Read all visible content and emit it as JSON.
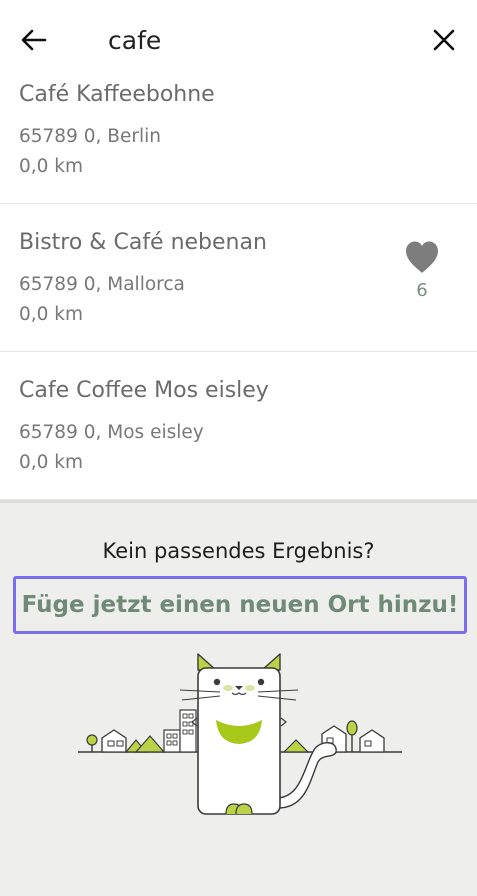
{
  "search": {
    "query": "cafe"
  },
  "results": [
    {
      "name": "Café Kaffeebohne",
      "address": "65789 0, Berlin",
      "distance": "0,0 km"
    },
    {
      "name": "Bistro & Café nebenan",
      "address": "65789 0, Mallorca",
      "distance": "0,0 km",
      "favorites": "6"
    },
    {
      "name": "Cafe Coffee Mos eisley",
      "address": "65789 0, Mos eisley",
      "distance": "0,0 km"
    }
  ],
  "footer": {
    "no_result_text": "Kein passendes Ergebnis?",
    "add_place_label": "Füge jetzt einen neuen Ort hinzu!"
  },
  "colors": {
    "accent_green": "#a8c81a",
    "link_green": "#6f8a77",
    "highlight_purple": "#7b6cf0"
  }
}
